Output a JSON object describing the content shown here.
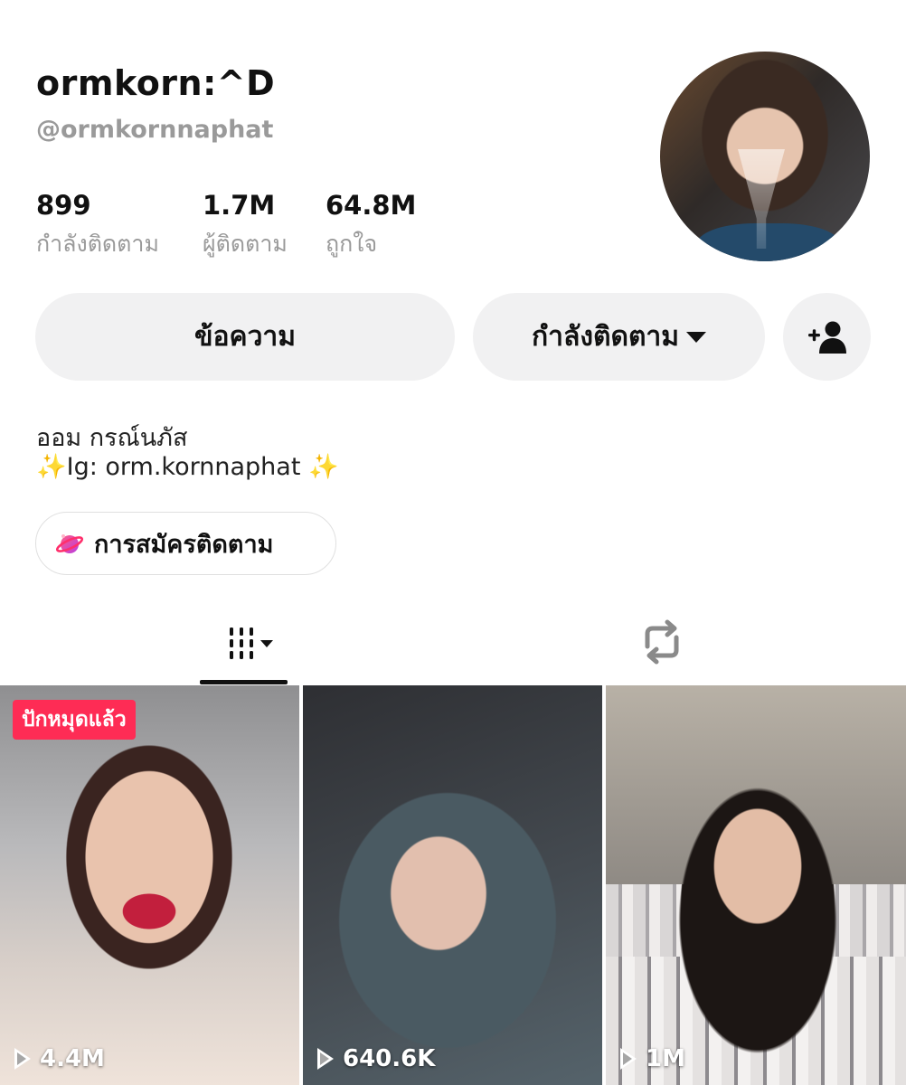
{
  "profile": {
    "display_name": "ormkorn:^D",
    "handle": "@ormkornnaphat"
  },
  "stats": {
    "following_count": "899",
    "following_label": "กำลังติดตาม",
    "followers_count": "1.7M",
    "followers_label": "ผู้ติดตาม",
    "likes_count": "64.8M",
    "likes_label": "ถูกใจ"
  },
  "actions": {
    "message_label": "ข้อความ",
    "following_label": "กำลังติดตาม"
  },
  "bio": {
    "line1": "ออม กรณ์นภัส",
    "line2": "✨Ig: orm.kornnaphat ✨"
  },
  "subscription": {
    "label": "การสมัครติดตาม"
  },
  "videos": [
    {
      "views": "4.4M",
      "badge": "ปักหมุดแล้ว"
    },
    {
      "views": "640.6K"
    },
    {
      "views": "1M"
    }
  ],
  "icons": {
    "add_friend": "person-plus-icon",
    "subscription": "planet-icon",
    "videos_tab": "grid-icon",
    "reposts_tab": "repost-icon",
    "play": "play-icon"
  },
  "colors": {
    "accent": "#fe2c55",
    "button_bg": "#f1f1f2",
    "secondary_text": "#9a9a9a"
  }
}
